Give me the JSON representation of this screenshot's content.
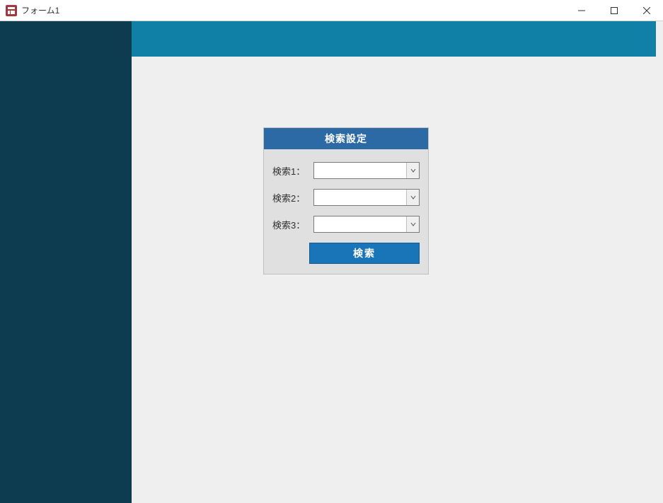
{
  "window": {
    "title": "フォーム1"
  },
  "panel": {
    "header": "検索設定",
    "fields": {
      "f1": {
        "label": "検索1：",
        "value": ""
      },
      "f2": {
        "label": "検索2：",
        "value": ""
      },
      "f3": {
        "label": "検索3：",
        "value": ""
      }
    },
    "search_button": "検索"
  },
  "colors": {
    "banner": "#1180a6",
    "sidebar": "#0d3b4f",
    "panel_header": "#2b6aa5",
    "button": "#1a74b8"
  }
}
